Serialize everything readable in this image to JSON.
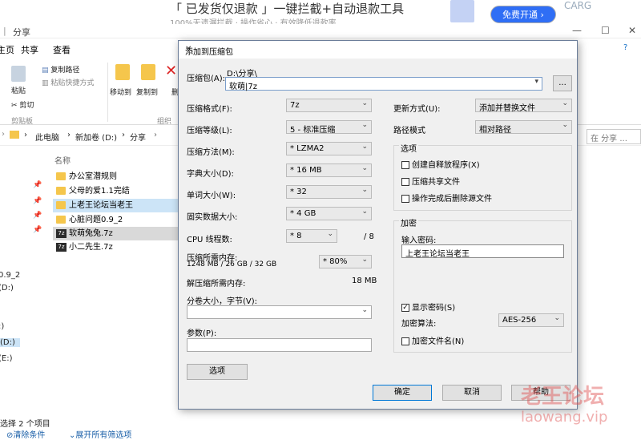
{
  "ad": {
    "title": "「 已发货仅退款 」一键拦截+自动退款工具",
    "sub": "100%无遗漏拦截 · 操作省心 · 有效降低退款率",
    "button": "免费开通 ›",
    "fragment": "CARG"
  },
  "explorer": {
    "title": "分享",
    "menu_sep": "|",
    "window": {
      "min": "—",
      "max": "☐",
      "close": "✕"
    },
    "tabs": [
      "主页",
      "共享",
      "查看"
    ],
    "ribbon": {
      "paste": "粘贴",
      "cut": "剪切",
      "copy_path": "复制路径",
      "paste_shortcut": "粘贴快捷方式",
      "clipboard": "剪贴板",
      "move_to": "移动到",
      "copy_to": "复制到",
      "organize": "组织",
      "delete_fragment": "删"
    },
    "address": {
      "crumbs": [
        "此电脑",
        "新加卷 (D:)",
        "分享"
      ],
      "search": "在 分享 ..."
    },
    "column": "名称",
    "files": [
      {
        "name": "办公室潜规则",
        "type": "folder",
        "pinned": true
      },
      {
        "name": "父母的爱1.1完结",
        "type": "folder",
        "pinned": true
      },
      {
        "name": "上老王论坛当老王",
        "type": "folder",
        "pinned": true
      },
      {
        "name": "心脏问题0.9_2",
        "type": "folder",
        "pinned": true
      },
      {
        "name": "软萌兔兔.7z",
        "type": "7z"
      },
      {
        "name": "小二先生.7z",
        "type": "7z"
      }
    ],
    "nav": [
      "0.9_2",
      "(D:)",
      ":)",
      "(D:)",
      "(E:)"
    ],
    "status": "选择 2 个项目",
    "status_links": [
      "清除条件",
      "展开所有筛选项"
    ]
  },
  "dialog": {
    "title": "添加到压缩包",
    "close": "✕",
    "archive_label": "压缩包(A):",
    "archive_path": "D:\\分享\\",
    "archive_name": "软萌|7z",
    "browse": "...",
    "left": [
      {
        "label": "压缩格式(F):",
        "value": "7z"
      },
      {
        "label": "压缩等级(L):",
        "value": "5 - 标准压缩"
      },
      {
        "label": "压缩方法(M):",
        "value": "* LZMA2"
      },
      {
        "label": "字典大小(D):",
        "value": "* 16 MB"
      },
      {
        "label": "单词大小(W):",
        "value": "* 32"
      },
      {
        "label": "固实数据大小:",
        "value": "* 4 GB"
      }
    ],
    "cpu_label": "CPU 线程数:",
    "cpu_value": "* 8",
    "cpu_total": "/ 8",
    "mem_label": "压缩所需内存:",
    "mem_detail": "1248 MB / 26 GB / 32 GB",
    "mem_value": "* 80%",
    "decomp_label": "解压缩所需内存:",
    "decomp_value": "18 MB",
    "split_label": "分卷大小，字节(V):",
    "split_value": "",
    "params_label": "参数(P):",
    "params_value": "",
    "options_button": "选项",
    "update_label": "更新方式(U):",
    "update_value": "添加并替换文件",
    "path_label": "路径模式",
    "path_value": "相对路径",
    "options_group": "选项",
    "options": [
      {
        "label": "创建自释放程序(X)",
        "checked": false
      },
      {
        "label": "压缩共享文件",
        "checked": false
      },
      {
        "label": "操作完成后删除源文件",
        "checked": false
      }
    ],
    "enc_group": "加密",
    "pw_label": "输入密码:",
    "pw_value": "上老王论坛当老王",
    "show_pw": "显示密码(S)",
    "enc_method_label": "加密算法:",
    "enc_method": "AES-256",
    "enc_names": "加密文件名(N)",
    "ok": "确定",
    "cancel": "取消",
    "help": "帮助"
  },
  "watermark": {
    "cn": "老王论坛",
    "url": "laowang.vip"
  }
}
